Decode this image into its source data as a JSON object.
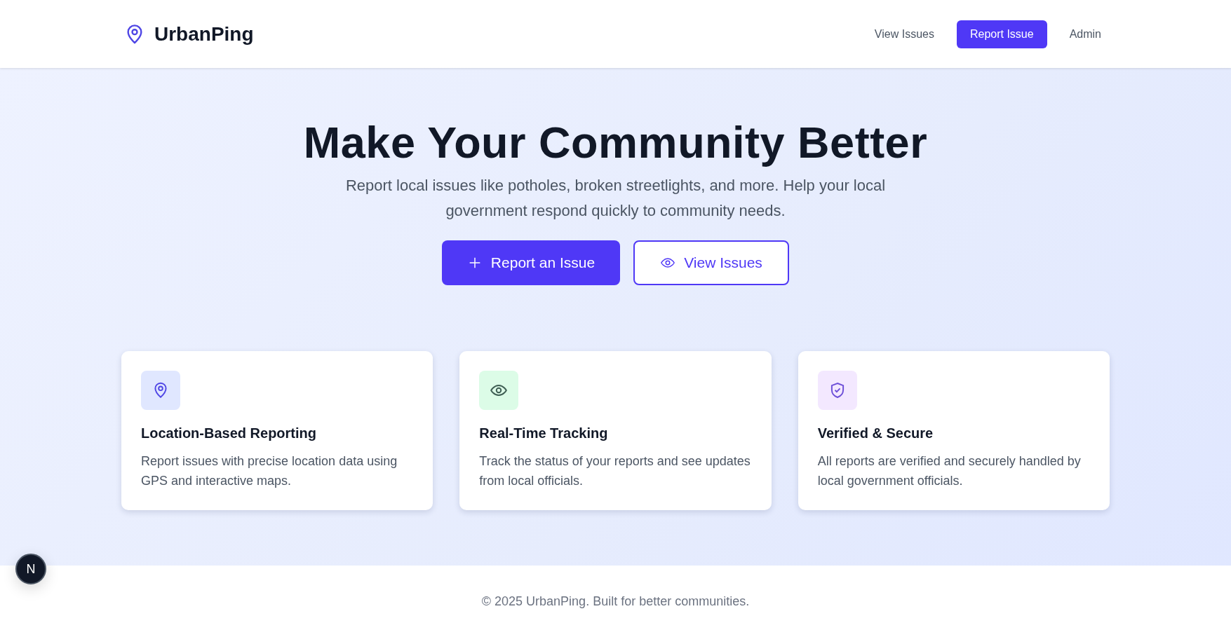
{
  "header": {
    "brand": "UrbanPing",
    "nav": [
      {
        "label": "View Issues",
        "selected": false
      },
      {
        "label": "Report Issue",
        "selected": true
      },
      {
        "label": "Admin",
        "selected": false
      }
    ]
  },
  "hero": {
    "title": "Make Your Community Better",
    "subtitle": "Report local issues like potholes, broken streetlights, and more. Help your local government respond quickly to community needs.",
    "buttons": [
      {
        "label": "Report an Issue",
        "kind": "primary"
      },
      {
        "label": "View Issues",
        "kind": "outline"
      }
    ]
  },
  "features": [
    {
      "color": "#e0e7ff",
      "title": "Location-Based Reporting",
      "text": "Report issues with precise location data using GPS and interactive maps."
    },
    {
      "color": "#dcfce7",
      "title": "Real-Time Tracking",
      "text": "Track the status of your reports and see updates from local officials."
    },
    {
      "color": "#f3e8ff",
      "title": "Verified & Secure",
      "text": "All reports are verified and securely handled by local government officials."
    }
  ],
  "dev_badge": {
    "label": "N"
  },
  "footer": {
    "text": "© 2025 UrbanPing. Built for better communities."
  }
}
